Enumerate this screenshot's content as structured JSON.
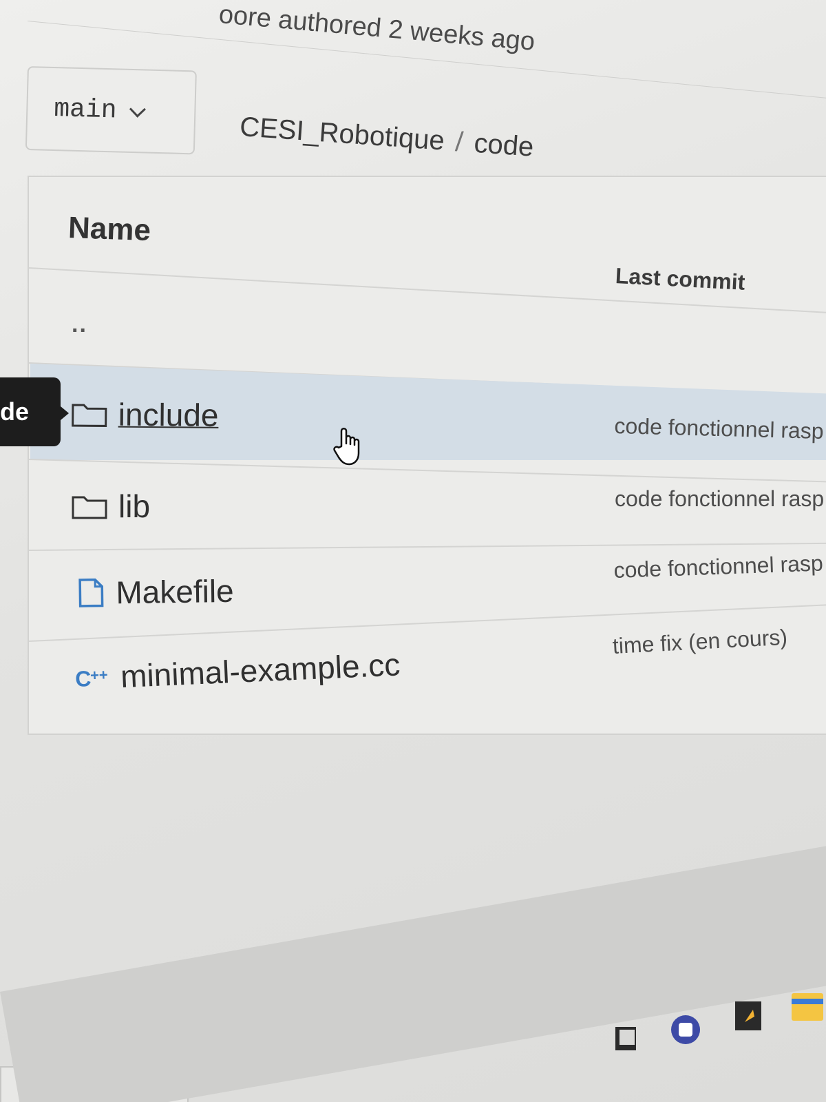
{
  "commit_info": "oore authored 2 weeks ago",
  "branch": {
    "name": "main"
  },
  "breadcrumb": {
    "repo": "CESI_Robotique",
    "separator": "/",
    "folder": "code"
  },
  "table": {
    "headers": {
      "name": "Name",
      "last_commit": "Last commit"
    },
    "parent": "..",
    "rows": [
      {
        "name": "include",
        "type": "folder",
        "icon": "folder-icon",
        "last_commit": "code fonctionnel rasp",
        "hovered": true
      },
      {
        "name": "lib",
        "type": "folder",
        "icon": "folder-icon",
        "last_commit": "code fonctionnel rasp"
      },
      {
        "name": "Makefile",
        "type": "file",
        "icon": "file-icon",
        "last_commit": "code fonctionnel rasp"
      },
      {
        "name": "minimal-example.cc",
        "type": "cpp",
        "icon": "cpp-icon",
        "last_commit": "time fix (en cours)"
      }
    ]
  },
  "tooltip": {
    "text": "de"
  },
  "colors": {
    "highlight": "#d3dde6",
    "file_icon": "#3b7dc4",
    "tooltip": "#1d1d1d"
  }
}
